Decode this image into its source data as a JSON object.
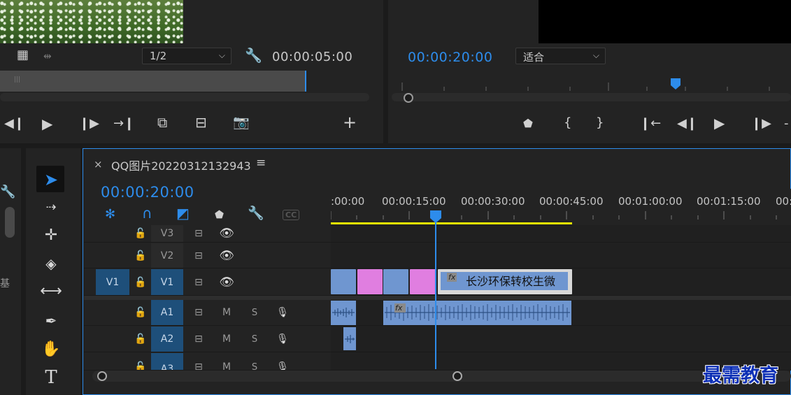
{
  "source_monitor": {
    "zoom_select": "1/2",
    "timecode": "00:00:05:00"
  },
  "program_monitor": {
    "timecode": "00:00:20:00",
    "fit_select": "适合"
  },
  "timeline": {
    "sequence_name": "QQ图片20220312132943",
    "timecode": "00:00:20:00",
    "ruler_labels": [
      ":00:00",
      "00:00:15:00",
      "00:00:30:00",
      "00:00:45:00",
      "00:01:00:00",
      "00:01:15:00",
      "00:"
    ],
    "tracks": {
      "v3": "V3",
      "v2": "V2",
      "v1_src": "V1",
      "v1": "V1",
      "a1": "A1",
      "a2": "A2",
      "a3": "A3",
      "mute": "M",
      "solo": "S"
    },
    "title_clip": "长沙环保转校生微",
    "fx_badge": "fx",
    "cc_label": "CC"
  },
  "left_panel_char": "基",
  "watermark": "最需教育",
  "colors": {
    "accent": "#2d8ceb",
    "clip_blue": "#6f96d0",
    "clip_pink": "#e07ee0",
    "work_area": "#e6e600",
    "track_blue": "#1e4f7a"
  }
}
